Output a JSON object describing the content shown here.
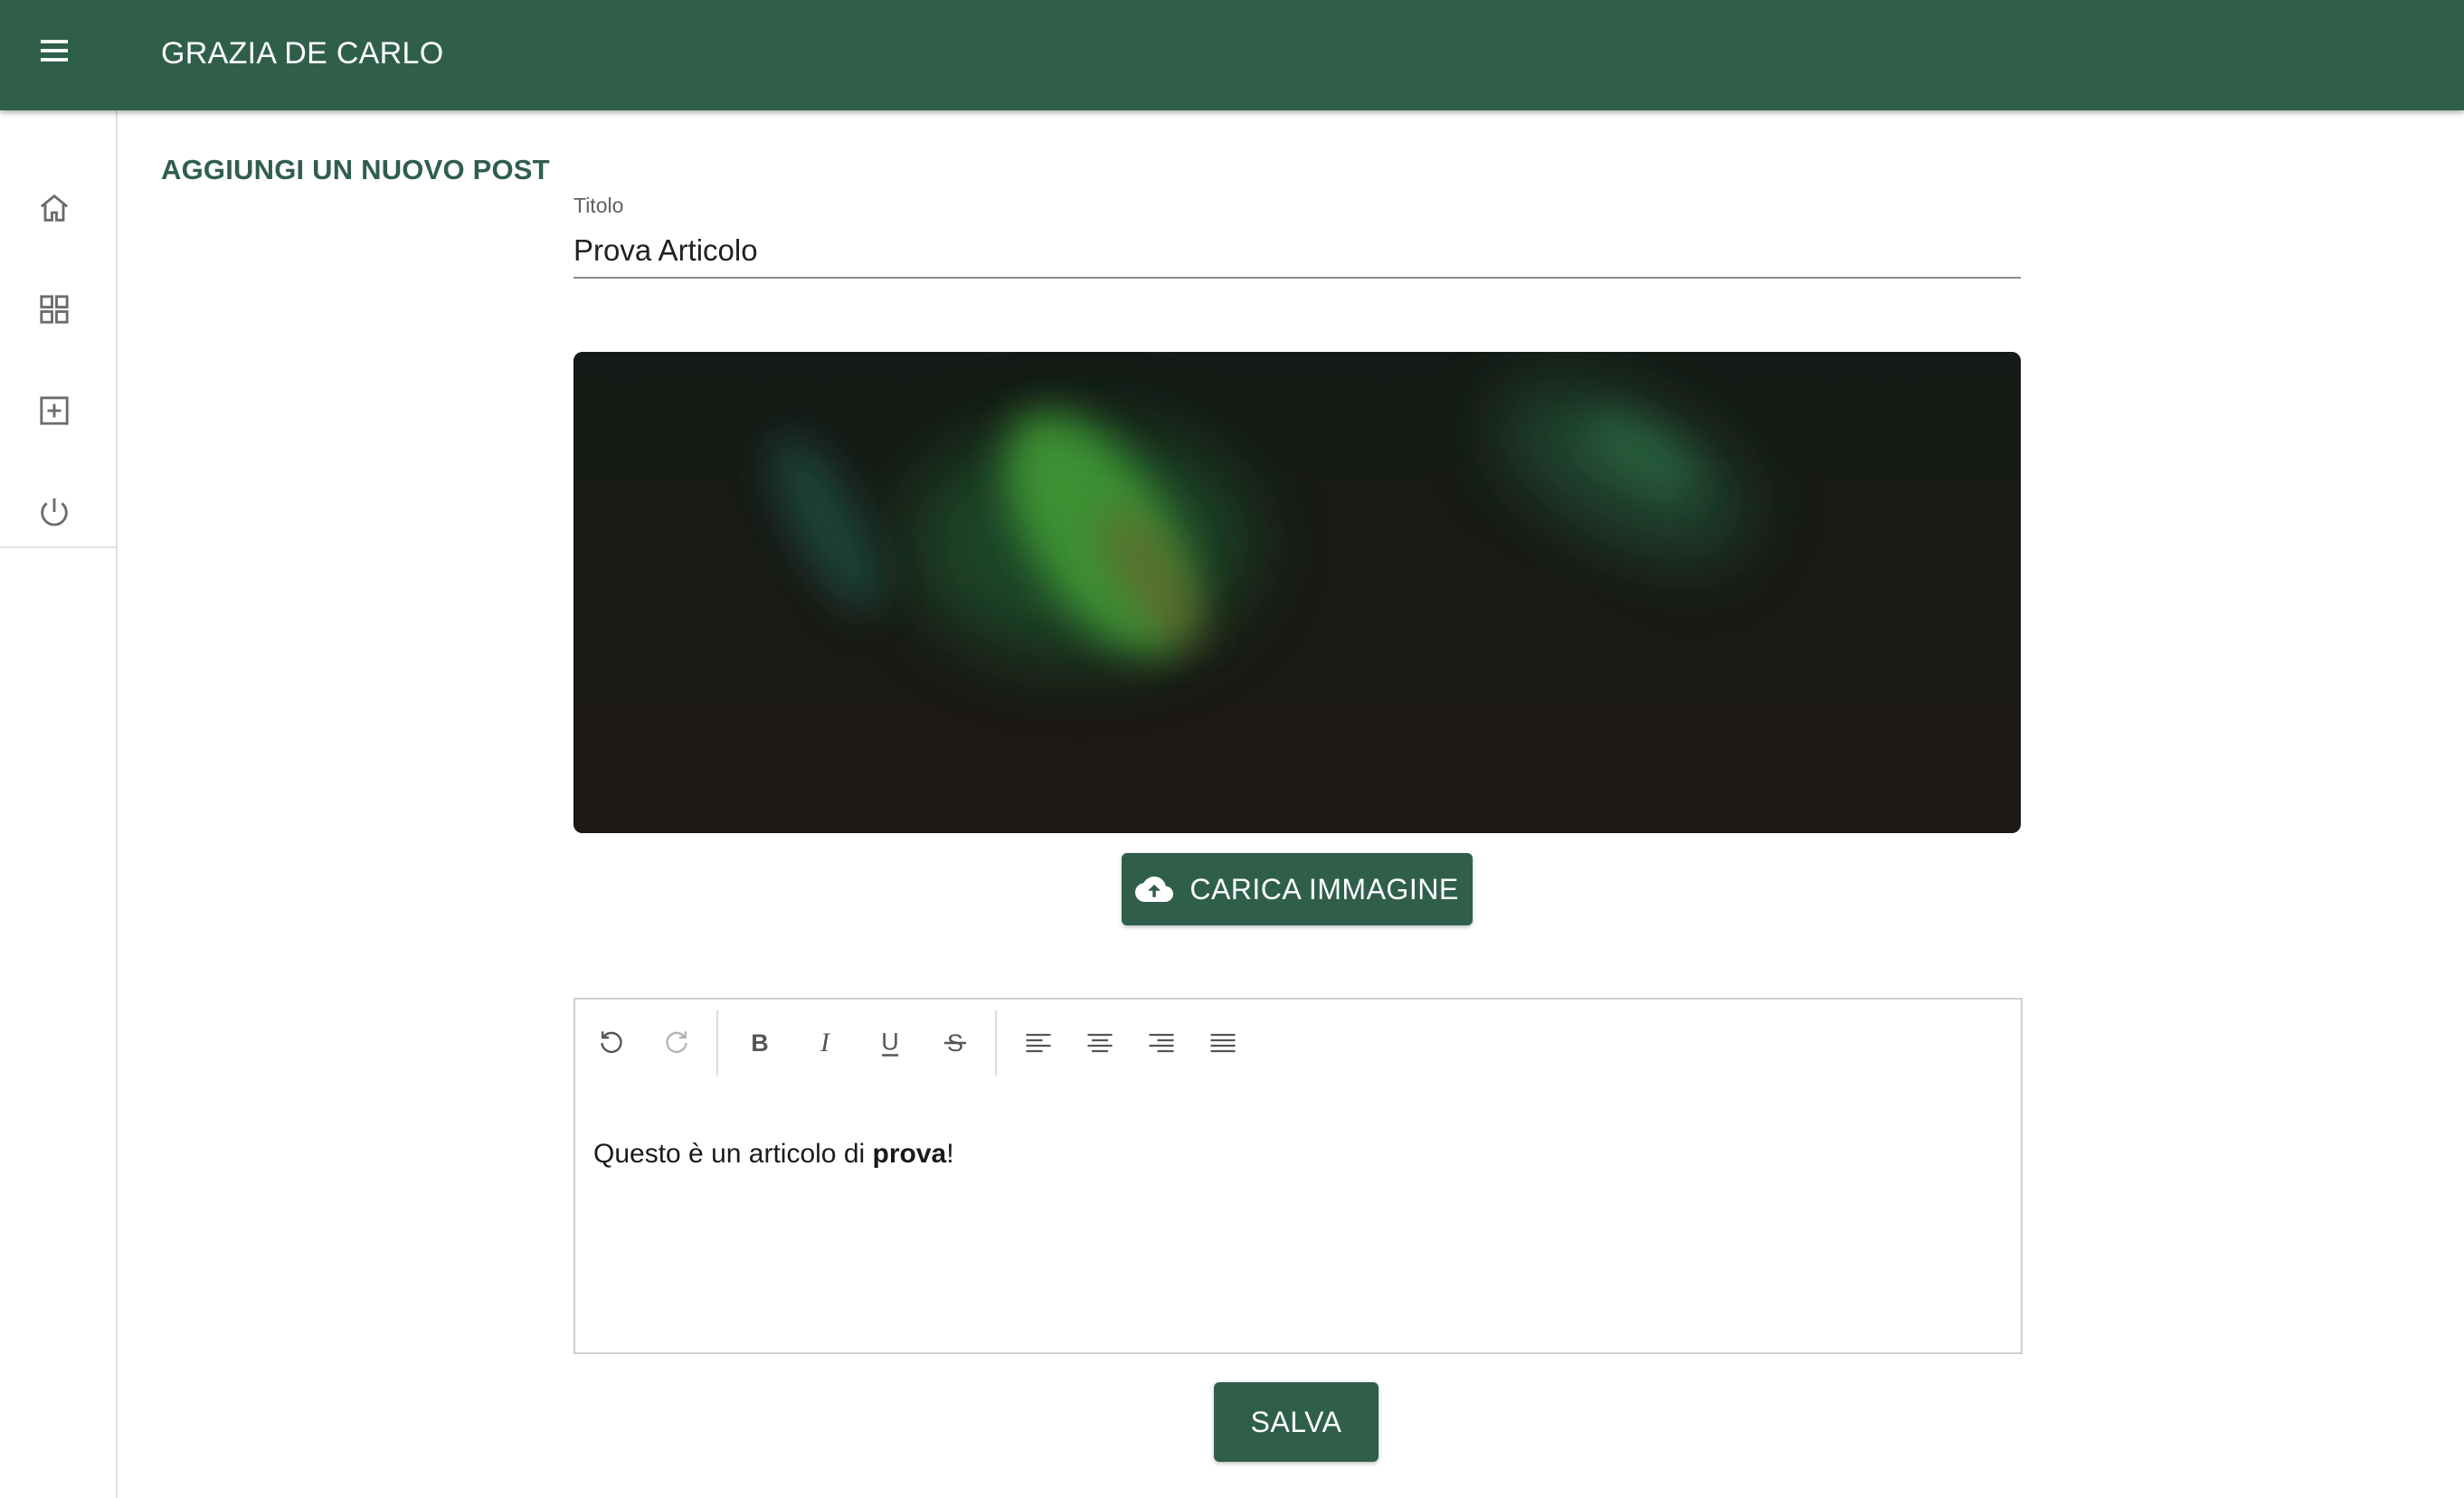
{
  "header": {
    "title": "GRAZIA DE CARLO",
    "menu_icon": "menu-icon"
  },
  "sidebar": {
    "items": [
      {
        "name": "home",
        "icon": "home-icon"
      },
      {
        "name": "dashboard",
        "icon": "grid-icon"
      },
      {
        "name": "add-post",
        "icon": "add-box-icon"
      },
      {
        "name": "logout",
        "icon": "power-icon"
      }
    ]
  },
  "main": {
    "heading": "AGGIUNGI UN NUOVO POST",
    "title_field": {
      "label": "Titolo",
      "value": "Prova Articolo"
    },
    "upload_button": {
      "label": "CARICA IMMAGINE",
      "icon": "cloud-upload-icon"
    },
    "editor": {
      "toolbar": [
        "undo-icon",
        "redo-icon",
        "bold-icon",
        "italic-icon",
        "underline-icon",
        "strikethrough-icon",
        "align-left-icon",
        "align-center-icon",
        "align-right-icon",
        "align-justify-icon"
      ],
      "content_plain": "Questo è un articolo di ",
      "content_bold": "prova",
      "content_end": "!"
    },
    "save_button": {
      "label": "SALVA"
    }
  },
  "colors": {
    "primary": "#2f5f4b",
    "background": "#ffffff",
    "divider": "#e2e2e2"
  }
}
